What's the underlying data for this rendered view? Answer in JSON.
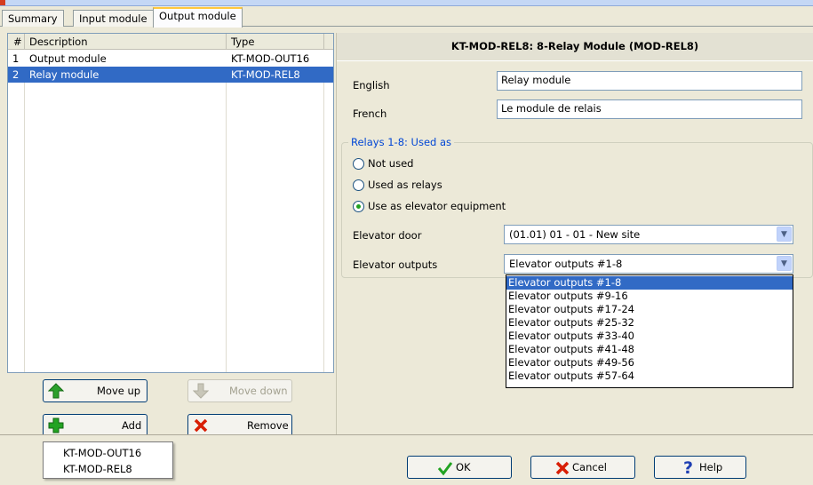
{
  "tabs": [
    {
      "label": "Summary"
    },
    {
      "label": "Input module"
    },
    {
      "label": "Output module"
    }
  ],
  "list": {
    "columns": [
      "#",
      "Description",
      "Type"
    ],
    "rows": [
      {
        "num": "1",
        "description": "Output module",
        "type": "KT-MOD-OUT16"
      },
      {
        "num": "2",
        "description": "Relay module",
        "type": "KT-MOD-REL8"
      }
    ]
  },
  "buttons": {
    "move_up": "Move up",
    "move_down": "Move down",
    "add": "Add",
    "remove": "Remove",
    "ok": "OK",
    "cancel": "Cancel",
    "help": "Help"
  },
  "add_menu": [
    "KT-MOD-OUT16",
    "KT-MOD-REL8"
  ],
  "module": {
    "title": "KT-MOD-REL8: 8-Relay Module (MOD-REL8)",
    "english_label": "English",
    "english_value": "Relay module",
    "french_label": "French",
    "french_value": "Le module de relais"
  },
  "relays": {
    "group_title": "Relays 1-8: Used as",
    "options": [
      "Not used",
      "Used as relays",
      "Use as elevator equipment"
    ],
    "selected_option": "Use as elevator equipment",
    "elevator_door_label": "Elevator door",
    "elevator_door_value": "(01.01) 01 - 01 - New site",
    "elevator_outputs_label": "Elevator outputs",
    "elevator_outputs_value": "Elevator outputs #1-8",
    "elevator_outputs_options": [
      "Elevator outputs #1-8",
      "Elevator outputs #9-16",
      "Elevator outputs #17-24",
      "Elevator outputs #25-32",
      "Elevator outputs #33-40",
      "Elevator outputs #41-48",
      "Elevator outputs #49-56",
      "Elevator outputs #57-64"
    ]
  },
  "colors": {
    "selection": "#316ac5",
    "group_title": "#0046d5",
    "active_tab_accent": "#ffc83c",
    "remove_x": "#d81e05",
    "add_plus": "#22a322",
    "arrow_up": "#2ba02b",
    "help_icon": "#1f3fb3"
  },
  "icons": {
    "move_up": "arrow-up-icon",
    "move_down": "arrow-down-icon",
    "add": "plus-icon",
    "remove": "x-icon",
    "ok": "checkmark-icon",
    "cancel": "x-icon",
    "help": "question-icon"
  }
}
